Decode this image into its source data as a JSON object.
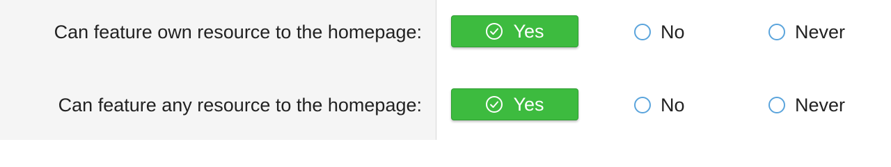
{
  "settings": {
    "rows": [
      {
        "label": "Can feature own resource to the homepage:",
        "yes_label": "Yes",
        "no_label": "No",
        "never_label": "Never",
        "selected": "Yes"
      },
      {
        "label": "Can feature any resource to the homepage:",
        "yes_label": "Yes",
        "no_label": "No",
        "never_label": "Never",
        "selected": "Yes"
      }
    ]
  },
  "icons": {
    "yes": "check-circle-icon",
    "radio": "radio-unselected-icon"
  },
  "colors": {
    "selected_bg": "#3dbb3f",
    "radio_border": "#5aa4dc",
    "label_panel_bg": "#f5f5f5"
  }
}
